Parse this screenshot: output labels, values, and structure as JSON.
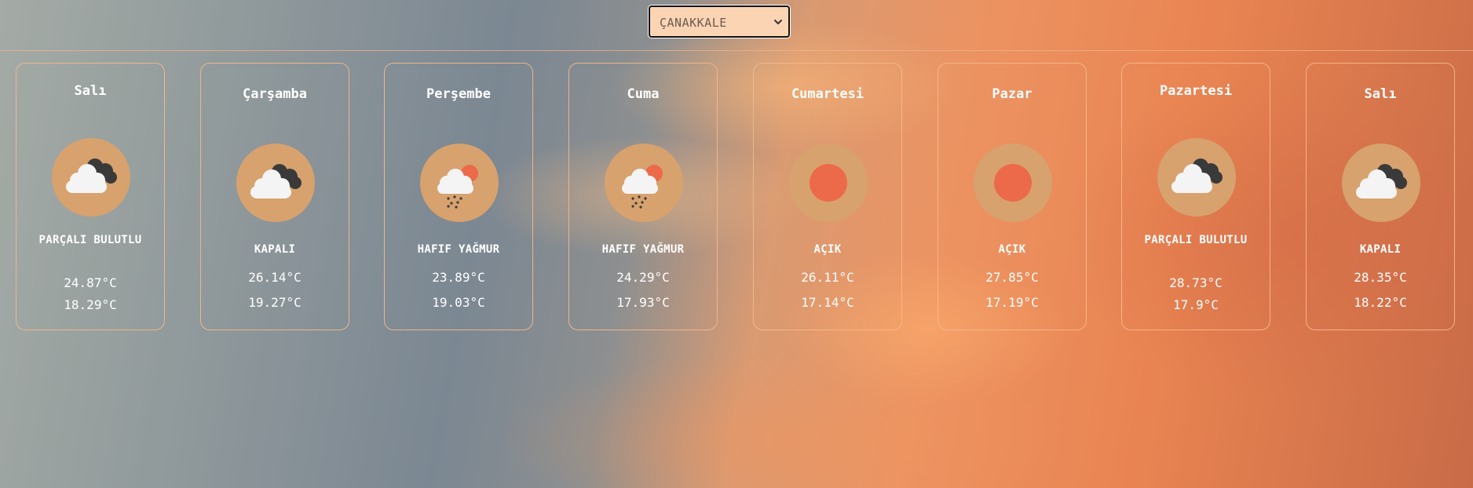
{
  "city_select": {
    "value": "ÇANAKKALE",
    "icon": "chevron-down-icon"
  },
  "days": [
    {
      "day": "Salı",
      "condition": "PARÇALI BULUTLU",
      "icon": "partly-cloudy-icon",
      "max": "24.87°C",
      "min": "18.29°C"
    },
    {
      "day": "Çarşamba",
      "condition": "KAPALI",
      "icon": "overcast-cloud-icon",
      "max": "26.14°C",
      "min": "19.27°C"
    },
    {
      "day": "Perşembe",
      "condition": "HAFIF YAĞMUR",
      "icon": "light-rain-icon",
      "max": "23.89°C",
      "min": "19.03°C"
    },
    {
      "day": "Cuma",
      "condition": "HAFIF YAĞMUR",
      "icon": "light-rain-icon",
      "max": "24.29°C",
      "min": "17.93°C"
    },
    {
      "day": "Cumartesi",
      "condition": "AÇIK",
      "icon": "clear-sun-icon",
      "max": "26.11°C",
      "min": "17.14°C"
    },
    {
      "day": "Pazar",
      "condition": "AÇIK",
      "icon": "clear-sun-icon",
      "max": "27.85°C",
      "min": "17.19°C"
    },
    {
      "day": "Pazartesi",
      "condition": "PARÇALI BULUTLU",
      "icon": "partly-cloudy-icon",
      "max": "28.73°C",
      "min": "17.9°C"
    },
    {
      "day": "Salı",
      "condition": "KAPALI",
      "icon": "overcast-cloud-icon",
      "max": "28.35°C",
      "min": "18.22°C"
    }
  ],
  "colors": {
    "icon_circle": "#d7a26e",
    "sun": "#ec6a4a",
    "card_border": "#f5b98c",
    "select_bg": "#fbd4b4"
  }
}
